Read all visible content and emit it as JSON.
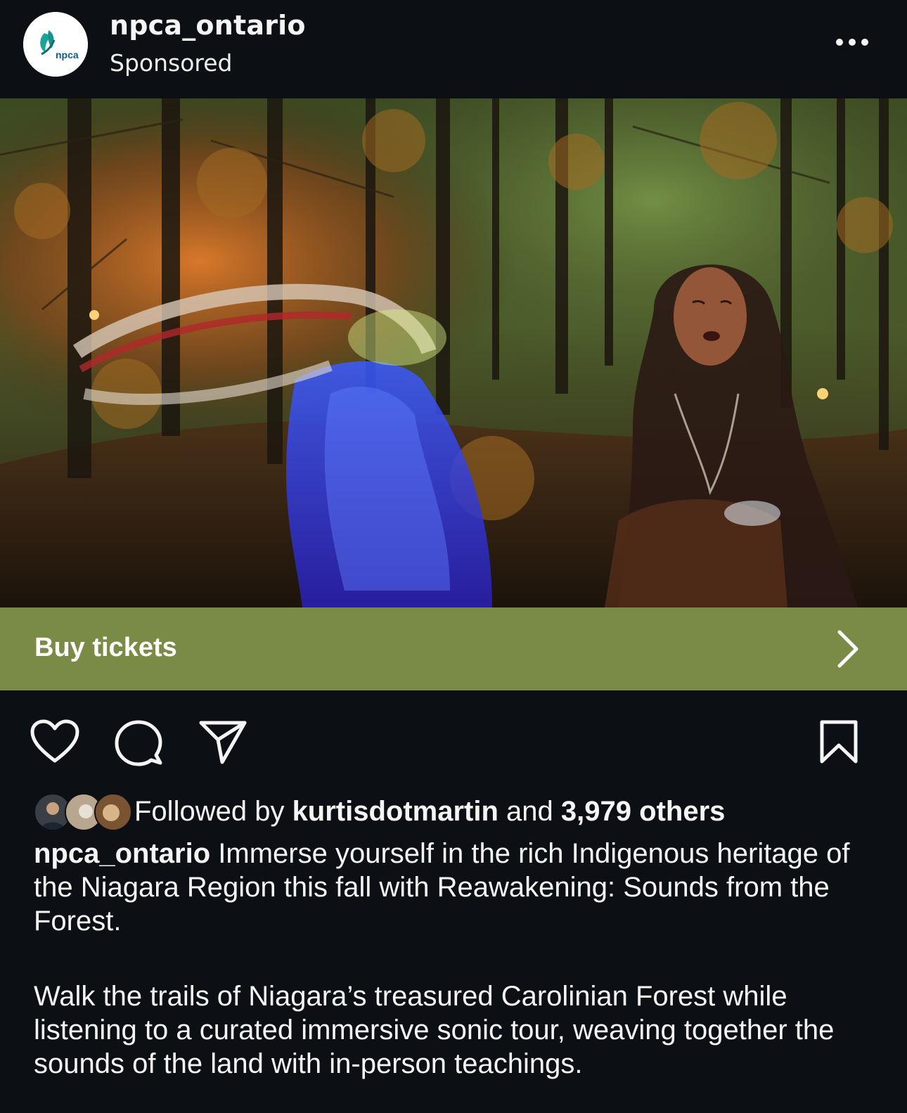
{
  "post": {
    "username": "npca_ontario",
    "sponsored_label": "Sponsored",
    "avatar_text": "npca",
    "more_icon": "more-horizontal-icon"
  },
  "media": {
    "alt": "Forest scene with a dancer in blue regalia and a singing woman overlaid among autumn trees"
  },
  "cta": {
    "label": "Buy tickets",
    "color": "#798b45",
    "icon": "chevron-right-icon"
  },
  "actions": {
    "like_icon": "heart-icon",
    "comment_icon": "comment-icon",
    "share_icon": "send-icon",
    "save_icon": "bookmark-icon"
  },
  "followed": {
    "prefix": "Followed by",
    "user": "kurtisdotmartin",
    "conjunction": "and",
    "others": "3,979 others"
  },
  "caption": {
    "user": "npca_ontario",
    "paragraph1": "Immerse yourself in the rich Indigenous heritage of the Niagara Region this fall with Reawakening: Sounds from the Forest.",
    "paragraph2": "Walk the trails of Niagara’s treasured Carolinian Forest while listening to a curated immersive sonic tour, weaving together the sounds of the land with in-person teachings."
  }
}
